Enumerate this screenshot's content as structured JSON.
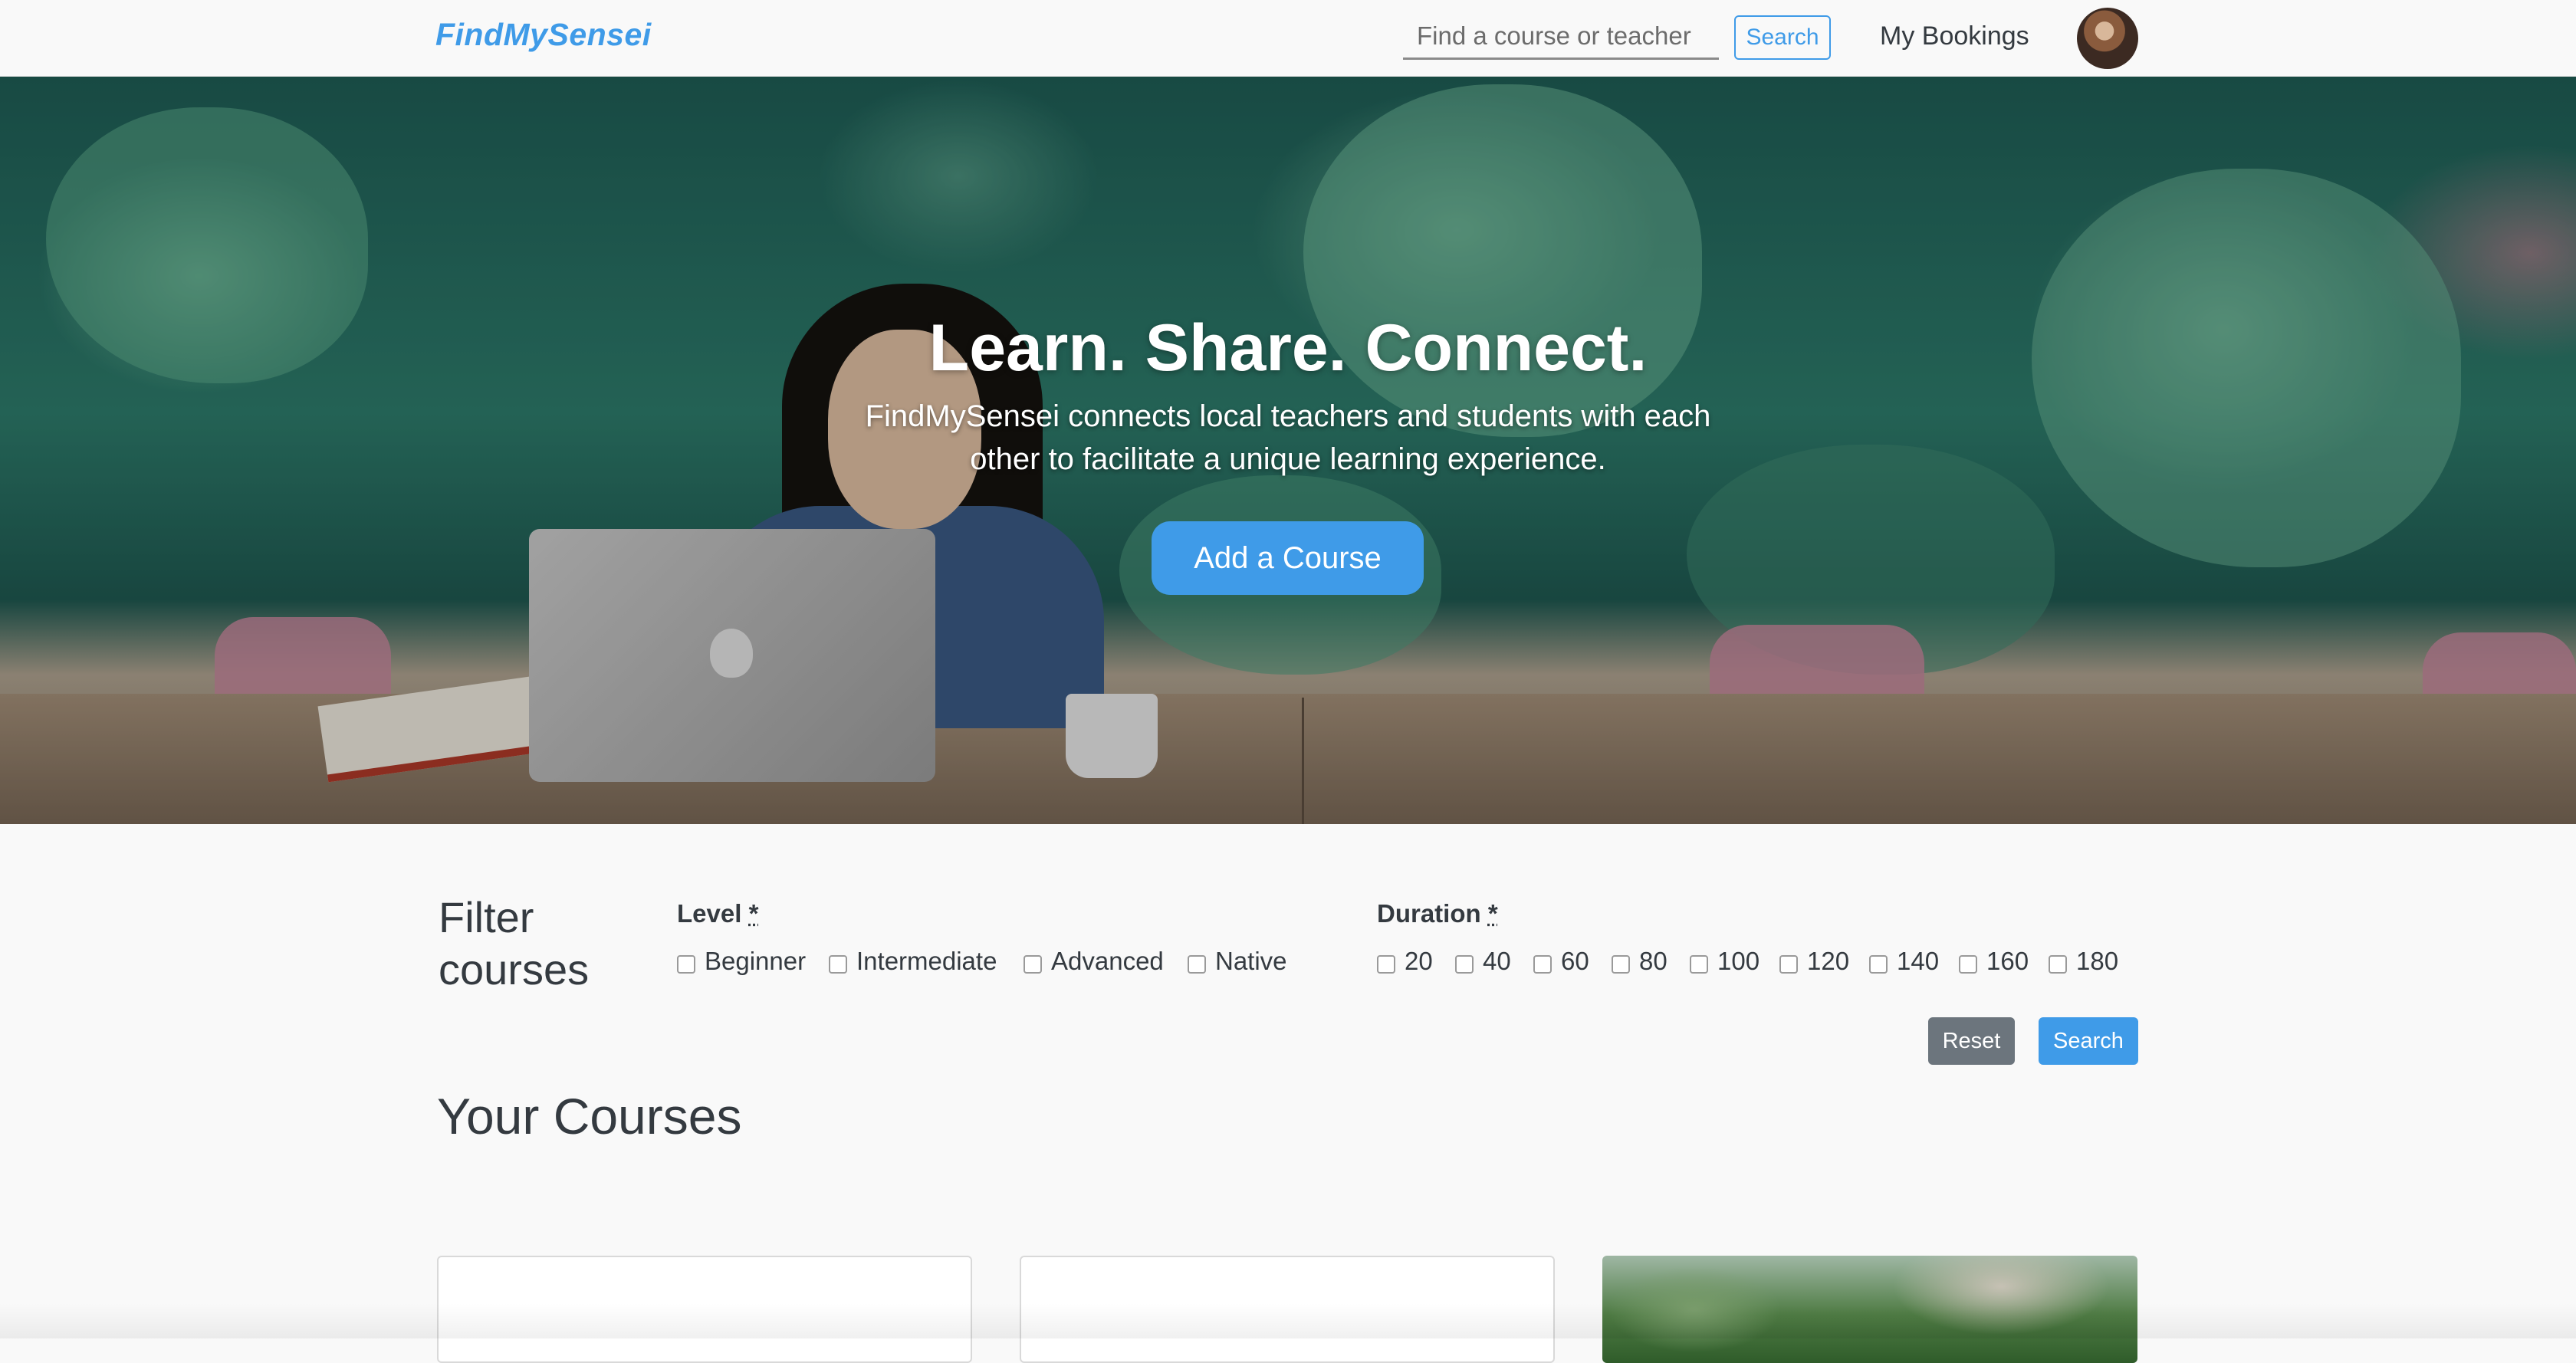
{
  "navbar": {
    "brand": "FindMySensei",
    "search_placeholder": "Find a course or teacher",
    "search_button": "Search",
    "bookings_link": "My Bookings"
  },
  "hero": {
    "title": "Learn. Share. Connect.",
    "subtitle": "FindMySensei connects local teachers and students with each other to facilitate a unique learning experience.",
    "cta": "Add a Course"
  },
  "filter": {
    "title_line1": "Filter",
    "title_line2": "courses",
    "level": {
      "label": "Level",
      "required_mark": "*",
      "options": [
        "Beginner",
        "Intermediate",
        "Advanced",
        "Native"
      ]
    },
    "duration": {
      "label": "Duration",
      "required_mark": "*",
      "options": [
        "20",
        "40",
        "60",
        "80",
        "100",
        "120",
        "140",
        "160",
        "180"
      ]
    },
    "reset_button": "Reset",
    "search_button": "Search"
  },
  "courses": {
    "title": "Your Courses"
  },
  "colors": {
    "accent": "#3f9be8",
    "secondary": "#6c757d",
    "text": "#343a40",
    "background": "#f9f9f9"
  }
}
